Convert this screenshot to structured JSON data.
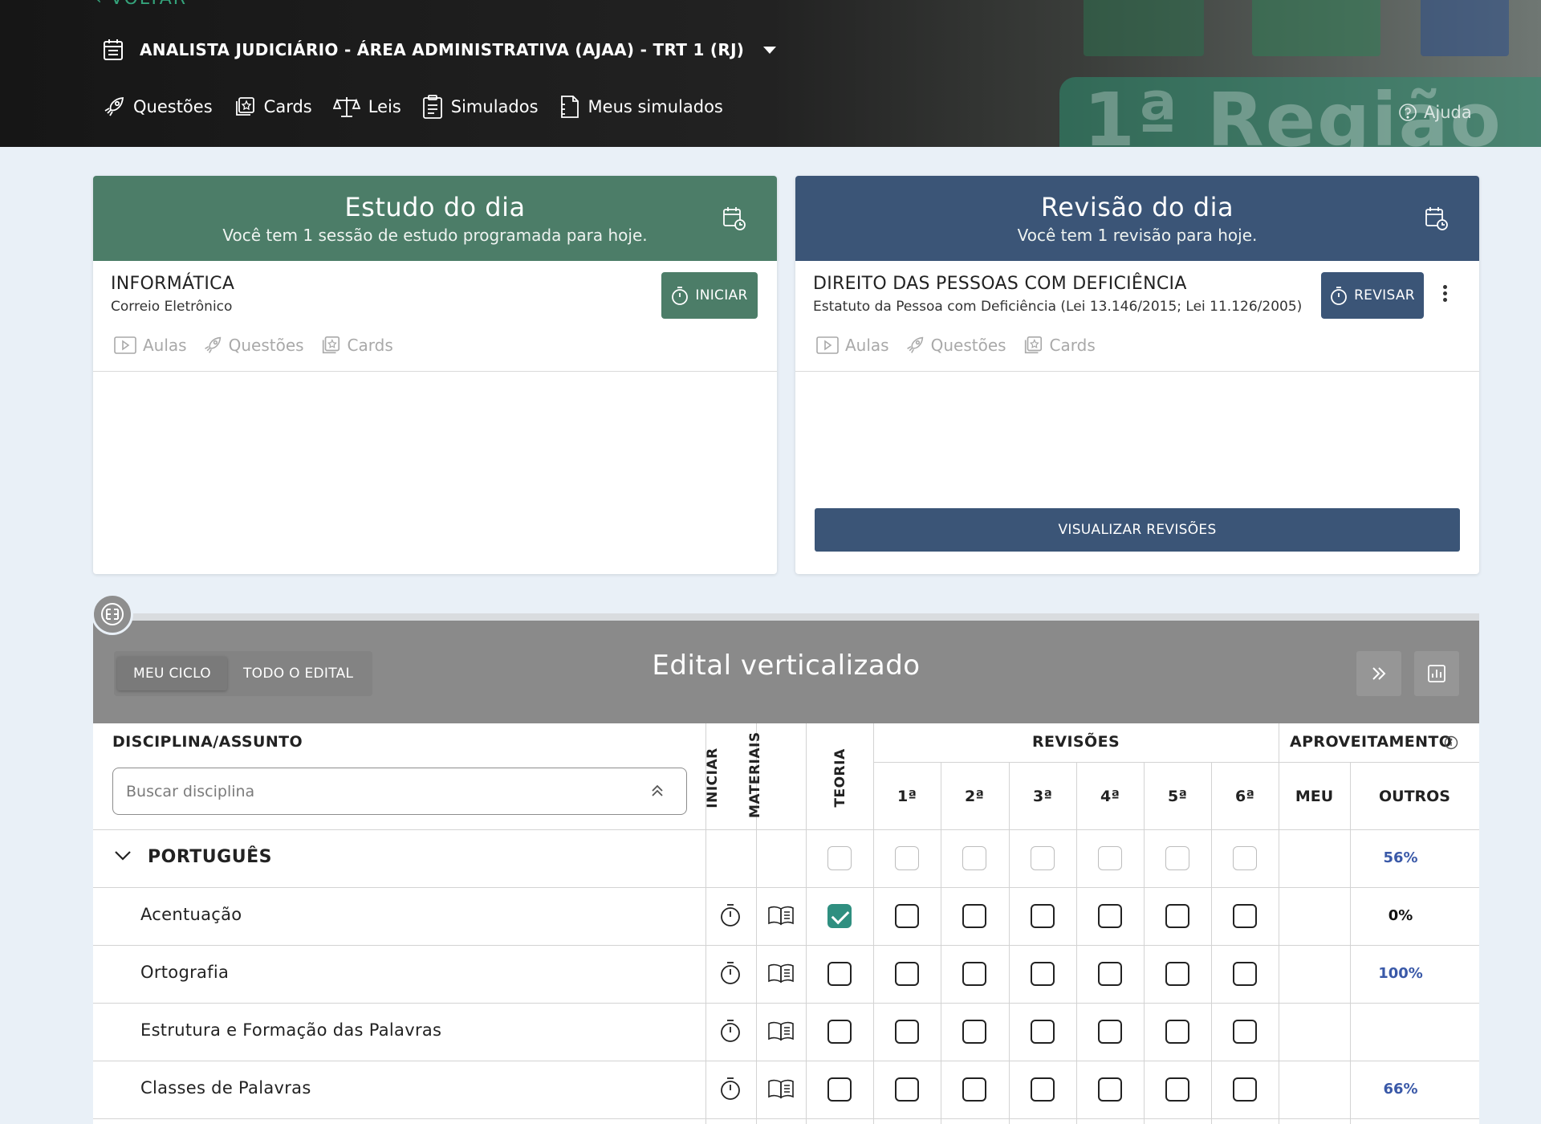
{
  "header": {
    "back_label": "VOLTAR",
    "course_title": "ANALISTA JUDICIÁRIO - ÁREA ADMINISTRATIVA (AJAA) - TRT 1 (RJ)",
    "background_word": "1ª Região",
    "nav": [
      {
        "label": "Questões",
        "icon": "rocket-icon"
      },
      {
        "label": "Cards",
        "icon": "cards-icon"
      },
      {
        "label": "Leis",
        "icon": "scales-icon"
      },
      {
        "label": "Simulados",
        "icon": "clipboard-icon"
      },
      {
        "label": "Meus simulados",
        "icon": "document-icon"
      }
    ],
    "help_label": "Ajuda"
  },
  "estudo": {
    "title": "Estudo do dia",
    "subtitle": "Você tem 1 sessão de estudo programada para hoje.",
    "topic": "INFORMÁTICA",
    "subtopic": "Correio Eletrônico",
    "button": "INICIAR",
    "links": [
      "Aulas",
      "Questões",
      "Cards"
    ]
  },
  "revisao": {
    "title": "Revisão do dia",
    "subtitle": "Você tem 1 revisão para hoje.",
    "topic": "DIREITO DAS PESSOAS COM DEFICIÊNCIA",
    "subtopic": "Estatuto da Pessoa com Deficiência (Lei 13.146/2015; Lei 11.126/2005)",
    "button": "REVISAR",
    "links": [
      "Aulas",
      "Questões",
      "Cards"
    ],
    "view_all": "VISUALIZAR REVISÕES"
  },
  "edital": {
    "title": "Edital verticalizado",
    "tabs": [
      "MEU CICLO",
      "TODO O EDITAL"
    ],
    "active_tab": "MEU CICLO"
  },
  "table": {
    "col_disciplina": "DISCIPLINA/ASSUNTO",
    "search_placeholder": "Buscar disciplina",
    "col_iniciar": "INICIAR",
    "col_materiais": "MATERIAIS",
    "col_teoria": "TEORIA",
    "col_revisoes": "REVISÕES",
    "revisoes": [
      "1ª",
      "2ª",
      "3ª",
      "4ª",
      "5ª",
      "6ª"
    ],
    "col_aproveitamento": "APROVEITAMENTO",
    "col_meu": "MEU",
    "col_outros": "OUTROS",
    "rows": [
      {
        "name": "PORTUGUÊS",
        "group": true,
        "teoria": false,
        "outros": "56%"
      },
      {
        "name": "Acentuação",
        "group": false,
        "teoria": true,
        "outros": "0%"
      },
      {
        "name": "Ortografia",
        "group": false,
        "teoria": false,
        "outros": "100%"
      },
      {
        "name": "Estrutura e Formação das Palavras",
        "group": false,
        "teoria": false,
        "outros": ""
      },
      {
        "name": "Classes de Palavras",
        "group": false,
        "teoria": false,
        "outros": "66%"
      }
    ]
  },
  "colors": {
    "estudo_green": "#4c7d68",
    "revisao_blue": "#3b5577",
    "checked_teal": "#2f8f80",
    "percent_blue": "#3a59a8"
  }
}
